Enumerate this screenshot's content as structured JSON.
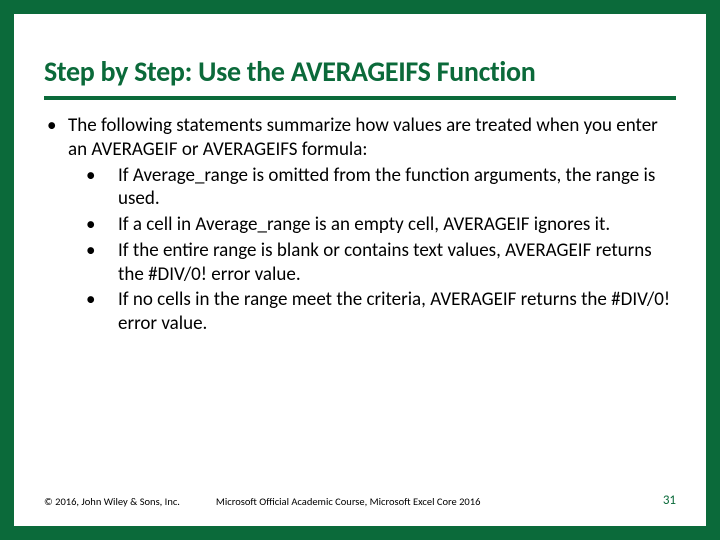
{
  "title": "Step by Step: Use the AVERAGEIFS Function",
  "intro": "The following statements summarize how values are treated when you enter an AVERAGEIF or AVERAGEIFS formula:",
  "points": [
    "If Average_range is omitted from the function arguments, the range is used.",
    "If a cell in Average_range is an empty cell, AVERAGEIF ignores it.",
    "If the entire range is blank or contains text values, AVERAGEIF returns the #DIV/0! error value.",
    "If no cells in the range meet the criteria, AVERAGEIF returns the #DIV/0! error value."
  ],
  "footer": {
    "copyright": "© 2016, John Wiley & Sons, Inc.",
    "course": "Microsoft Official Academic Course, Microsoft Excel Core 2016",
    "page": "31"
  }
}
